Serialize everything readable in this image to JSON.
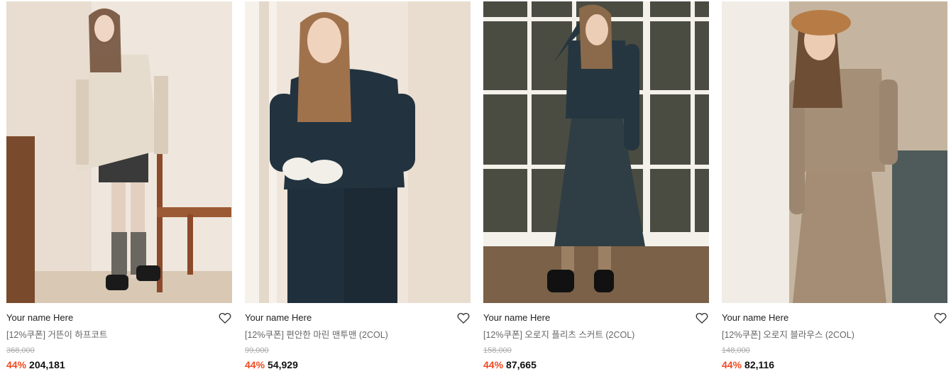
{
  "products": [
    {
      "brand": "Your name Here",
      "name": "[12%쿠폰] 거뜬이 하프코트",
      "original_price": "368,000",
      "discount": "44%",
      "price": "204,181",
      "photo_bg": "#ece3d8",
      "garment_color": "#e6dccd"
    },
    {
      "brand": "Your name Here",
      "name": "[12%쿠폰] 편안한 마린 맨투맨 (2COL)",
      "original_price": "99,000",
      "discount": "44%",
      "price": "54,929",
      "photo_bg": "#efe6dc",
      "garment_color": "#1f2f3c"
    },
    {
      "brand": "Your name Here",
      "name": "[12%쿠폰] 오로지 플리츠 스커트 (2COL)",
      "original_price": "158,000",
      "discount": "44%",
      "price": "87,665",
      "photo_bg": "#3a3c38",
      "garment_color": "#2f3e44"
    },
    {
      "brand": "Your name Here",
      "name": "[12%쿠폰] 오로지 블라우스 (2COL)",
      "original_price": "148,000",
      "discount": "44%",
      "price": "82,116",
      "photo_bg": "#d9cdbd",
      "garment_color": "#a48d74"
    }
  ],
  "icons": {
    "wishlist": "heart-outline-icon"
  },
  "colors": {
    "discount": "#ef4b22",
    "strike_price": "#aaaaaa",
    "brand_text": "#222222"
  }
}
